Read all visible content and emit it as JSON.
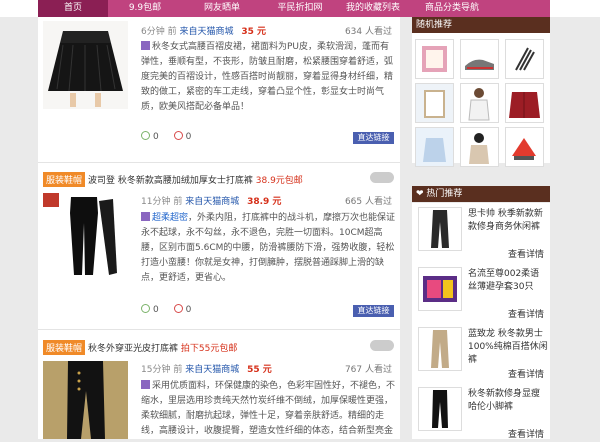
{
  "nav": {
    "items": [
      "首页",
      "9.9包邮",
      "网友晒单",
      "平民折扣网",
      "我的收藏列表",
      "商品分类导航"
    ]
  },
  "cards": [
    {
      "time": "6分钟 前",
      "source": "来自天猫商城",
      "price": "35 元",
      "views": "634 人看过",
      "desc_highlight": "",
      "desc": "秋冬女式高腰百褶皮裙，裙面料为PU皮，柔软滑润，蓬而有弹性，垂顺有型，不丧形，防皱且耐磨，松紧腰围穿着舒适，弧度完美的百褶设计，性感百搭时尚靓丽，穿着显得身材纤细，精致的做工，紧密的车工走线，穿着凸显个性，彰显女士时尚气质，欧美风搭配必备单品！",
      "up": "0",
      "down": "0",
      "go": "直达链接"
    },
    {
      "tag": "服装鞋帽",
      "title": "波司登 秋冬新款高腰加绒加厚女士打底裤",
      "title_price": "38.9元包邮",
      "time": "11分钟 前",
      "source": "来自天猫商城",
      "price": "38.9 元",
      "views": "665 人看过",
      "desc_highlight": "超柔超密",
      "desc": "，外柔内阻，打底裤中的战斗机，摩擦万次也能保证永不起球，永不勾丝，永不退色，完胜一切面料。10CM超高腰，区别市面5.6CM的中腰，防滑裤腰防下滑，强势收腹，轻松打造小蛮腰！你就是女神，打倒臃肿，摆脱普通踩脚上滑的缺点，更舒适，更省心。",
      "up": "0",
      "down": "0",
      "go": "直达链接"
    },
    {
      "tag": "服装鞋帽",
      "title": "秋冬外穿亚光皮打底裤",
      "title_price": "拍下55元包邮",
      "time": "15分钟 前",
      "source": "来自天猫商城",
      "price": "55 元",
      "views": "767 人看过",
      "desc": "采用优质面料，环保健康的染色，色彩牢固性好，不褪色，不缩水，里层选用珍贵纯天然竹炭纤维不倒绒，加厚保暖性更强，柔软细腻，耐磨抗起球，弹性十足，穿着亲肤舒适。精细的走线，高腰设计，收腹提臀，塑造女性纤细的体态，结合新型亮金工"
    }
  ],
  "sidebar": {
    "random_title": "随机推荐",
    "hot_title": "热门推荐",
    "hot_items": [
      {
        "title": "思卡帅 秋季新款新款修身商务休闲裤",
        "link": "查看详情"
      },
      {
        "title": "名流至尊002柔语丝薄避孕套30只",
        "link": "查看详情"
      },
      {
        "title": "蓝致龙 秋冬款男士100%纯棉百搭休闲裤",
        "link": "查看详情"
      },
      {
        "title": "秋冬新款修身显瘦哈伦小脚裤",
        "link": "查看详情"
      }
    ]
  }
}
